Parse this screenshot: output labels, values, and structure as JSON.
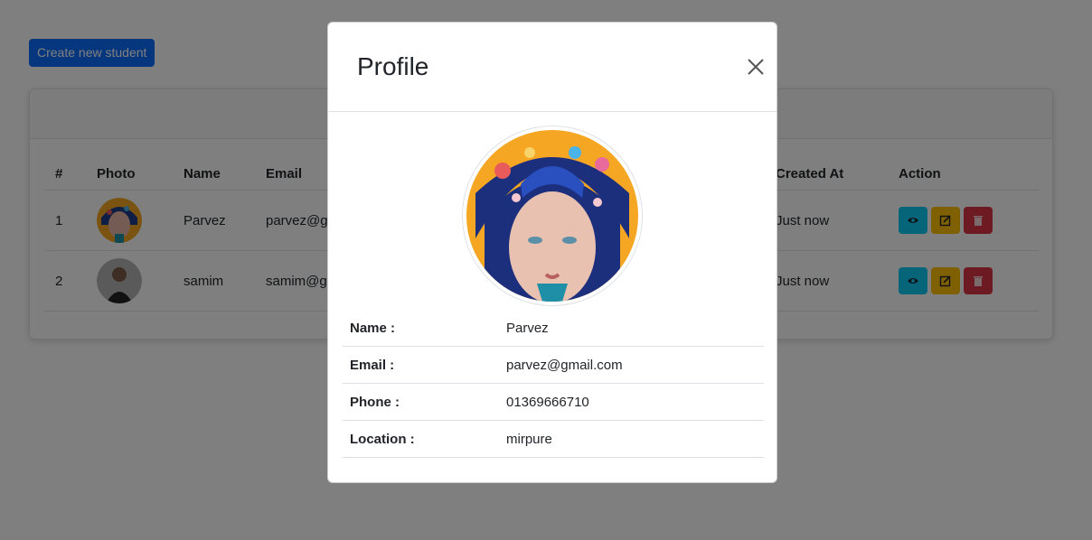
{
  "toolbar": {
    "create_label": "Create new student"
  },
  "table": {
    "headers": [
      "#",
      "Photo",
      "Name",
      "Email",
      "Created At",
      "Action"
    ],
    "rows": [
      {
        "num": "1",
        "name": "Parvez",
        "email": "parvez@gmail.com",
        "created": "Just now"
      },
      {
        "num": "2",
        "name": "samim",
        "email": "samim@gmail.com",
        "created": "Just now"
      }
    ],
    "actions": [
      "eye-icon",
      "edit-icon",
      "trash-icon"
    ]
  },
  "modal": {
    "title": "Profile",
    "close_icon": "close-icon",
    "details": [
      {
        "label": "Name :",
        "value": "Parvez"
      },
      {
        "label": "Email :",
        "value": "parvez@gmail.com"
      },
      {
        "label": "Phone :",
        "value": "01369666710"
      },
      {
        "label": "Location :",
        "value": "mirpure"
      }
    ]
  },
  "colors": {
    "primary": "#0d6efd",
    "info": "#0dcaf0",
    "warning": "#ffc107",
    "danger": "#dc3545"
  }
}
